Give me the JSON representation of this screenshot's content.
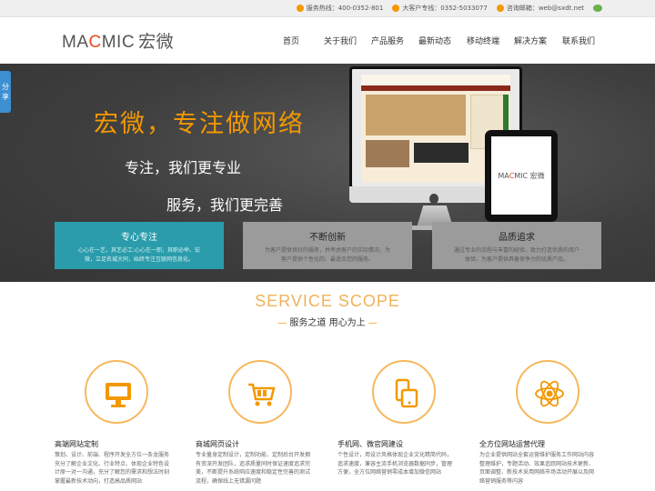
{
  "topbar": {
    "hotline": "服务热线：400-0352-801",
    "vip": "大客户专线：0352-5033077",
    "email": "咨询邮箱：web@sxdt.net"
  },
  "header": {
    "logo_a": "MA",
    "logo_b": "C",
    "logo_c": "MIC",
    "logo_cn": "宏微"
  },
  "nav": [
    "首页",
    "关于我们",
    "产品服务",
    "最新动态",
    "移动终端",
    "解决方案",
    "联系我们"
  ],
  "share": {
    "label_1": "分",
    "label_2": "享"
  },
  "banner": {
    "headline": "宏微，专注做网络",
    "line2": "专注，我们更专业",
    "line3": "服务，我们更完善",
    "ipad_logo_a": "MA",
    "ipad_logo_b": "C",
    "ipad_logo_c": "MIC 宏微"
  },
  "tiles": [
    {
      "title": "专心专注",
      "desc": "心心在一艺，其艺必工;心心在一职，其职必举。宏微，立足名城大同，始终专注互联网信息化。"
    },
    {
      "title": "不断创新",
      "desc": "为客户提供良好的服务，并考虑客户的实际情况，为客户提供个性化的、最适合您的服务。"
    },
    {
      "title": "品质追求",
      "desc": "通过专业的流程与丰富的经验，致力打造优质的用户体验，为客户提供具备竞争力的优质产品。"
    }
  ],
  "services": {
    "title": "SERVICE SCOPE",
    "subtitle": "服务之道 用心为上",
    "items": [
      {
        "title": "高端网站定制",
        "desc": "策划、设计、前端、程序开发全方位一条龙服务充分了解企业文化、行业特点、体现企业特色设计原一对一沟通，充分了解您的需求和想法时刻掌握最新技术动向，打造高品质网站"
      },
      {
        "title": "商城网页设计",
        "desc": "专业量身定制设计，定制功能、定制后台开发拥有资深开发团队，追求质量同时保证速度追求完美，不断提升系统响应速度和稳定性完善的测试流程，确保线上无错漏问题"
      },
      {
        "title": "手机网、微官网建设",
        "desc": "个性设计，用设计风格体现企业文化精简代码，追求速度，兼容主流手机浏览器数据同步，管理方便，全方位网络营销零成本增加微信网站"
      },
      {
        "title": "全方位网站运营代理",
        "desc": "为企业提供网站全套运营维护服务工作网站内容整理维护，专题活动、效果追踪网站技术更新、页面调整、新技术采用网络市场活动开展以及网络营销服务等内容"
      }
    ]
  }
}
